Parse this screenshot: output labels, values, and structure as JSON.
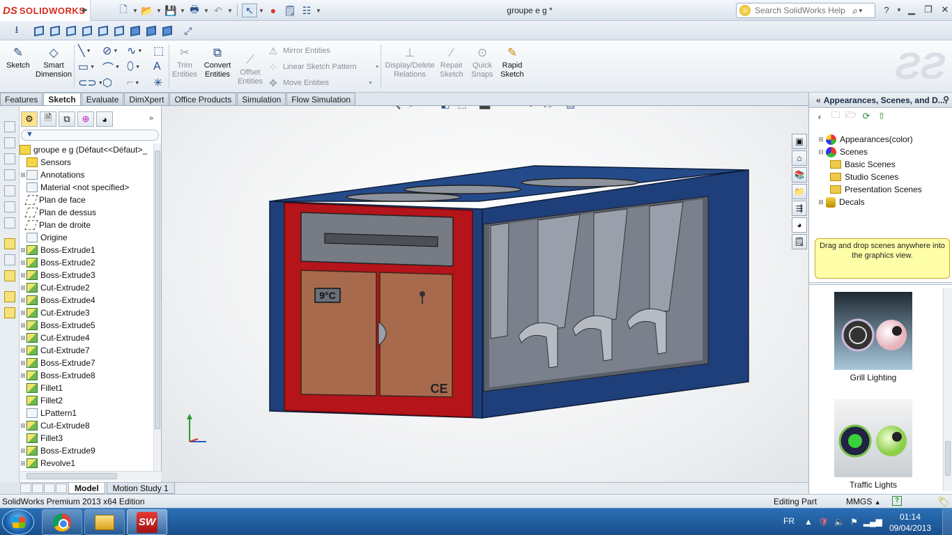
{
  "app": {
    "logo_brand": "SOLIDWORKS",
    "doc_title": "groupe e g *",
    "help_search_placeholder": "Search SolidWorks Help"
  },
  "command_manager": {
    "sketch": "Sketch",
    "smart_dimension": "Smart Dimension",
    "trim_entities": "Trim Entities",
    "convert_entities": "Convert Entities",
    "offset_entities": "Offset Entities",
    "mirror_entities": "Mirror Entities",
    "linear_sketch_pattern": "Linear Sketch Pattern",
    "move_entities": "Move Entities",
    "display_delete_relations": "Display/Delete Relations",
    "repair_sketch": "Repair Sketch",
    "quick_snaps": "Quick Snaps",
    "rapid_sketch": "Rapid Sketch"
  },
  "tabs": [
    "Features",
    "Sketch",
    "Evaluate",
    "DimXpert",
    "Office Products",
    "Simulation",
    "Flow Simulation"
  ],
  "active_tab": "Sketch",
  "feature_tree": {
    "root": "groupe e g  (Défaut<<Défaut>_",
    "items": [
      {
        "label": "Sensors",
        "icon": "sensor-icon",
        "expandable": false
      },
      {
        "label": "Annotations",
        "icon": "annotations-icon",
        "expandable": true
      },
      {
        "label": "Material <not specified>",
        "icon": "material-icon",
        "expandable": false
      },
      {
        "label": "Plan de face",
        "icon": "plane-icon",
        "expandable": false
      },
      {
        "label": "Plan de dessus",
        "icon": "plane-icon",
        "expandable": false
      },
      {
        "label": "Plan de droite",
        "icon": "plane-icon",
        "expandable": false
      },
      {
        "label": "Origine",
        "icon": "origin-icon",
        "expandable": false
      },
      {
        "label": "Boss-Extrude1",
        "icon": "extrude-icon",
        "expandable": true
      },
      {
        "label": "Boss-Extrude2",
        "icon": "extrude-icon",
        "expandable": true
      },
      {
        "label": "Boss-Extrude3",
        "icon": "extrude-icon",
        "expandable": true
      },
      {
        "label": "Cut-Extrude2",
        "icon": "cut-extrude-icon",
        "expandable": true
      },
      {
        "label": "Boss-Extrude4",
        "icon": "extrude-icon",
        "expandable": true
      },
      {
        "label": "Cut-Extrude3",
        "icon": "cut-extrude-icon",
        "expandable": true
      },
      {
        "label": "Boss-Extrude5",
        "icon": "extrude-icon",
        "expandable": true
      },
      {
        "label": "Cut-Extrude4",
        "icon": "cut-extrude-icon",
        "expandable": true
      },
      {
        "label": "Cut-Extrude7",
        "icon": "cut-extrude-icon",
        "expandable": true
      },
      {
        "label": "Boss-Extrude7",
        "icon": "extrude-icon",
        "expandable": true
      },
      {
        "label": "Boss-Extrude8",
        "icon": "extrude-icon",
        "expandable": true
      },
      {
        "label": "Fillet1",
        "icon": "fillet-icon",
        "expandable": false
      },
      {
        "label": "Fillet2",
        "icon": "fillet-icon",
        "expandable": false
      },
      {
        "label": "LPattern1",
        "icon": "linear-pattern-icon",
        "expandable": false
      },
      {
        "label": "Cut-Extrude8",
        "icon": "cut-extrude-icon",
        "expandable": true
      },
      {
        "label": "Fillet3",
        "icon": "fillet-icon",
        "expandable": false
      },
      {
        "label": "Boss-Extrude9",
        "icon": "extrude-icon",
        "expandable": true
      },
      {
        "label": "Revolve1",
        "icon": "revolve-icon",
        "expandable": true
      }
    ]
  },
  "bottom_tabs": {
    "model": "Model",
    "motion_study": "Motion Study 1"
  },
  "task_pane": {
    "title": "Appearances, Scenes, and D...",
    "tree": {
      "appearances": "Appearances(color)",
      "scenes": "Scenes",
      "basic_scenes": "Basic Scenes",
      "studio_scenes": "Studio Scenes",
      "presentation_scenes": "Presentation Scenes",
      "decals": "Decals"
    },
    "tip": "Drag and drop scenes anywhere into the graphics view.",
    "thumbnails": [
      "Grill Lighting",
      "Traffic Lights"
    ]
  },
  "model": {
    "temperature_label": "9°C",
    "ce_mark": "CE",
    "colors": {
      "body": "#1f3f7a",
      "frame": "#b5141a",
      "door": "#a86a4d",
      "interior": "#6d7380"
    }
  },
  "status": {
    "edition": "SolidWorks Premium 2013 x64 Edition",
    "mode": "Editing Part",
    "units": "MMGS"
  },
  "taskbar": {
    "language": "FR",
    "time": "01:14",
    "date": "09/04/2013",
    "sw_label": "SW"
  }
}
